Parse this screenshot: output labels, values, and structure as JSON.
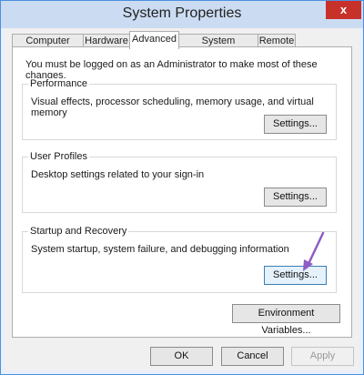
{
  "window": {
    "title": "System Properties",
    "close_label": "x"
  },
  "tabs": [
    {
      "label": "Computer Name",
      "active": false
    },
    {
      "label": "Hardware",
      "active": false
    },
    {
      "label": "Advanced",
      "active": true
    },
    {
      "label": "System Protection",
      "active": false
    },
    {
      "label": "Remote",
      "active": false
    }
  ],
  "advanced": {
    "admin_note": "You must be logged on as an Administrator to make most of these changes.",
    "performance": {
      "title": "Performance",
      "description": "Visual effects, processor scheduling, memory usage, and virtual memory",
      "button": "Settings..."
    },
    "user_profiles": {
      "title": "User Profiles",
      "description": "Desktop settings related to your sign-in",
      "button": "Settings..."
    },
    "startup_recovery": {
      "title": "Startup and Recovery",
      "description": "System startup, system failure, and debugging information",
      "button": "Settings..."
    },
    "env_button": "Environment Variables..."
  },
  "footer": {
    "ok": "OK",
    "cancel": "Cancel",
    "apply": "Apply"
  },
  "colors": {
    "titlebar": "#cbdcf2",
    "close": "#c7312a",
    "annotation_arrow": "#8e5cc4"
  }
}
